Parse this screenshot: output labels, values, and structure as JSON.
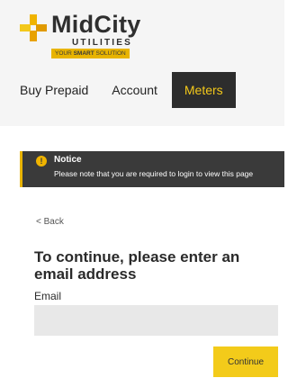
{
  "brand": {
    "name_part1": "Mid",
    "name_part2": "City",
    "subtitle": "UTILITIES",
    "tagline_pre": "YOUR ",
    "tagline_bold": "SMART",
    "tagline_post": " SOLUTION",
    "logo_icon": "plus-cross-icon",
    "accent_color": "#f3c81a"
  },
  "nav": {
    "items": [
      {
        "label": "Buy Prepaid"
      },
      {
        "label": "Account"
      },
      {
        "label": "Meters"
      }
    ],
    "active": "Meters"
  },
  "notice": {
    "icon": "exclamation-icon",
    "title": "Notice",
    "message": "Please note that you are required to login to view this page"
  },
  "back_link": "< Back",
  "form": {
    "heading": "To continue, please enter an email address",
    "email_label": "Email",
    "email_value": "",
    "email_placeholder": "",
    "submit_label": "Continue"
  }
}
